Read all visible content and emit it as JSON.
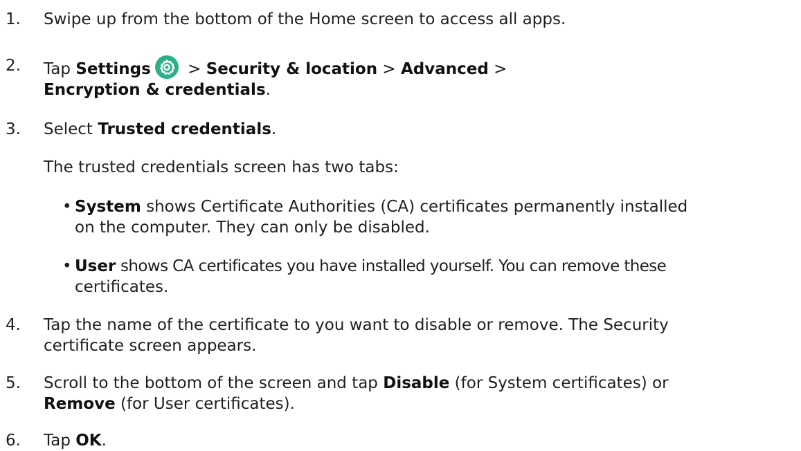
{
  "steps": [
    {
      "num": "1.",
      "text": "Swipe up from the bottom of the Home screen to access all apps."
    },
    {
      "num": "2.",
      "tap": "Tap",
      "settings": "Settings",
      "sep1": ">",
      "security": "Security & location",
      "sep2": ">",
      "advanced": "Advanced",
      "sep3": ">",
      "encryption": "Encryption & credentials",
      "end": "."
    },
    {
      "num": "3.",
      "select": "Select",
      "trusted": "Trusted credentials",
      "end": ".",
      "intro": "The trusted credentials screen has two tabs:",
      "bullets": [
        {
          "dot": "•",
          "bold": "System",
          "rest1": " shows Certificate Authorities (CA) certificates permanently installed",
          "rest2": "on the computer. They can only be disabled."
        },
        {
          "dot": "•",
          "bold": "User",
          "rest1": " shows CA certificates you have installed yourself. You can remove these",
          "rest2": "certificates."
        }
      ]
    },
    {
      "num": "4.",
      "line1": "Tap the name of the certificate to you want to disable or remove. The Security",
      "line2": "certificate screen appears."
    },
    {
      "num": "5.",
      "pre": "Scroll to the bottom of the screen and tap ",
      "disable": "Disable",
      "mid": " (for System certificates) or",
      "remove": "Remove",
      "post": " (for User certificates)."
    },
    {
      "num": "6.",
      "tap": "Tap ",
      "ok": "OK",
      "end": "."
    }
  ],
  "colors": {
    "text": "#1f1f1f",
    "settings_icon": "#2bb08a"
  },
  "icons": {
    "settings": "settings-gear-icon"
  }
}
